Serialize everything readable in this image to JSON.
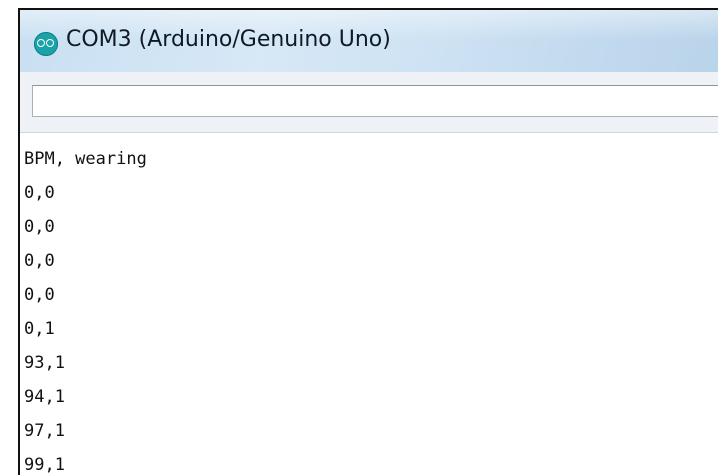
{
  "window": {
    "title": "COM3 (Arduino/Genuino Uno)",
    "app_icon": "arduino-logo-icon"
  },
  "send_input": {
    "value": ""
  },
  "serial_output": {
    "lines": [
      "BPM, wearing",
      "0,0",
      "0,0",
      "0,0",
      "0,0",
      "0,1",
      "93,1",
      "94,1",
      "97,1",
      "99,1"
    ]
  }
}
